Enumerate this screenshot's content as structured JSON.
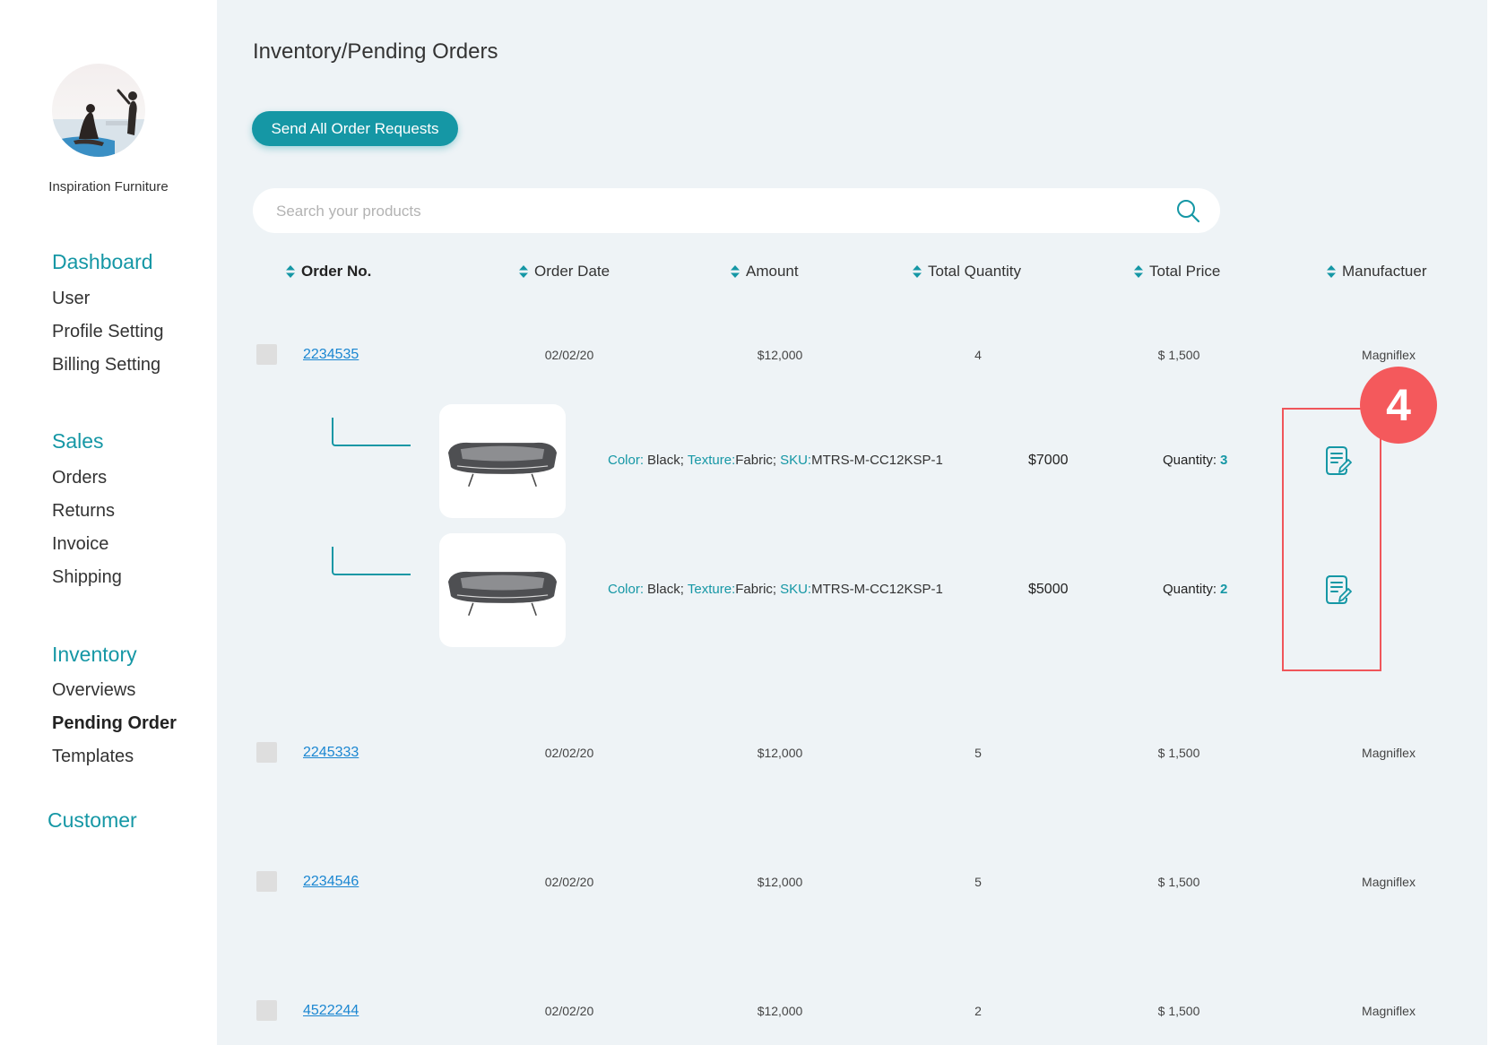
{
  "sidebar": {
    "company_name": "Inspiration Furniture",
    "active_item": "Pending Order",
    "sections": [
      {
        "title": "Dashboard",
        "items": [
          "User",
          "Profile Setting",
          "Billing Setting"
        ]
      },
      {
        "title": "Sales",
        "items": [
          "Orders",
          "Returns",
          "Invoice",
          "Shipping"
        ]
      },
      {
        "title": "Inventory",
        "items": [
          "Overviews",
          "Pending Order",
          "Templates"
        ]
      },
      {
        "title": "Customer",
        "items": []
      }
    ]
  },
  "page": {
    "breadcrumb": "Inventory/Pending Orders"
  },
  "toolbar": {
    "send_all_label": "Send All Order Requests"
  },
  "search": {
    "placeholder": "Search your products",
    "icon": "search-icon"
  },
  "table": {
    "sort_icon": "sort-icon",
    "columns": [
      "Order No.",
      "Order Date",
      "Amount",
      "Total Quantity",
      "Total Price",
      "Manufactuer"
    ],
    "detail_labels": {
      "color": "Color:",
      "texture": "Texture:",
      "sku": "SKU:",
      "quantity": "Quantity:",
      "separator": ";"
    },
    "orders": [
      {
        "order_no": "2234535",
        "date": "02/02/20",
        "amount": "$12,000",
        "total_quantity": "4",
        "total_price": "$ 1,500",
        "manufacturer": "Magniflex",
        "items": [
          {
            "color": "Black",
            "texture": "Fabric",
            "sku": "MTRS-M-CC12KSP-1",
            "price": "$7000",
            "quantity": "3",
            "edit_icon": "edit-document-icon"
          },
          {
            "color": "Black",
            "texture": "Fabric",
            "sku": "MTRS-M-CC12KSP-1",
            "price": "$5000",
            "quantity": "2",
            "edit_icon": "edit-document-icon"
          }
        ]
      },
      {
        "order_no": "2245333",
        "date": "02/02/20",
        "amount": "$12,000",
        "total_quantity": "5",
        "total_price": "$ 1,500",
        "manufacturer": "Magniflex",
        "items": []
      },
      {
        "order_no": "2234546",
        "date": "02/02/20",
        "amount": "$12,000",
        "total_quantity": "5",
        "total_price": "$ 1,500",
        "manufacturer": "Magniflex",
        "items": []
      },
      {
        "order_no": "4522244",
        "date": "02/02/20",
        "amount": "$12,000",
        "total_quantity": "2",
        "total_price": "$ 1,500",
        "manufacturer": "Magniflex",
        "items": []
      }
    ]
  },
  "annotation": {
    "label": "4"
  },
  "colors": {
    "accent": "#1597a5",
    "link": "#1a86d1",
    "annotation": "#f0555a",
    "background": "#eef3f6"
  }
}
